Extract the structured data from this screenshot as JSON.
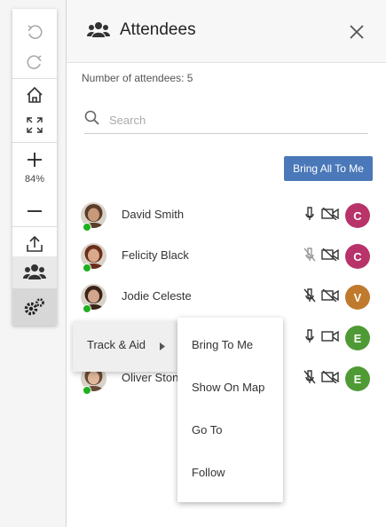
{
  "toolbar": {
    "zoom_level": "84%",
    "icons": [
      "undo-icon",
      "redo-icon",
      "home-icon",
      "fullscreen-icon",
      "zoom-in-icon",
      "zoom-out-icon",
      "export-icon",
      "attendees-icon",
      "settings-icon"
    ]
  },
  "panel": {
    "title": "Attendees",
    "attendee_count": "Number of attendees: 5",
    "search_placeholder": "Search",
    "bring_all_label": "Bring All To Me"
  },
  "attendees": [
    {
      "name": "David Smith",
      "badge": "C",
      "badge_color": "#b8336a",
      "mic": "on",
      "camera": "off",
      "online": true
    },
    {
      "name": "Felicity Black",
      "badge": "C",
      "badge_color": "#b8336a",
      "mic": "disabled",
      "camera": "off",
      "online": true
    },
    {
      "name": "Jodie Celeste",
      "badge": "V",
      "badge_color": "#c07a2e",
      "mic": "muted",
      "camera": "off",
      "online": true
    },
    {
      "name": "",
      "badge": "E",
      "badge_color": "#4e9a34",
      "mic": "on",
      "camera": "on",
      "online": true
    },
    {
      "name": "Oliver Ston",
      "badge": "E",
      "badge_color": "#4e9a34",
      "mic": "muted",
      "camera": "off",
      "online": true
    }
  ],
  "context_menu": {
    "item": "Track & Aid",
    "submenu": [
      "Bring To Me",
      "Show On Map",
      "Go To",
      "Follow"
    ]
  }
}
